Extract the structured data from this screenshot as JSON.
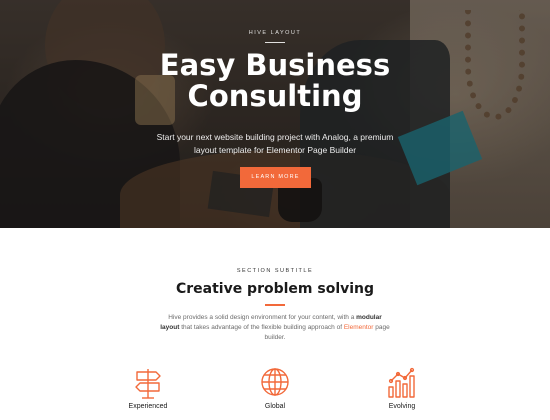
{
  "hero": {
    "eyebrow": "Hive Layout",
    "title_line1": "Easy Business",
    "title_line2": "Consulting",
    "description": "Start your next website building project with Analog, a premium layout template for Elementor Page Builder",
    "button_label": "Learn More"
  },
  "section": {
    "subtitle": "Section Subtitle",
    "title": "Creative problem solving",
    "desc_part1": "Hive provides a solid design environment for your content, with a ",
    "desc_bold": "modular layout",
    "desc_part2": " that takes advantage of the flexible building approach of ",
    "desc_link": "Elementor",
    "desc_part3": " page builder."
  },
  "features": [
    {
      "label": "Experienced",
      "icon": "signpost-icon"
    },
    {
      "label": "Global",
      "icon": "globe-icon"
    },
    {
      "label": "Evolving",
      "icon": "growth-chart-icon"
    }
  ],
  "colors": {
    "accent": "#f2693a",
    "heading": "#1a1a1a",
    "body_text": "#6b6b6b"
  }
}
